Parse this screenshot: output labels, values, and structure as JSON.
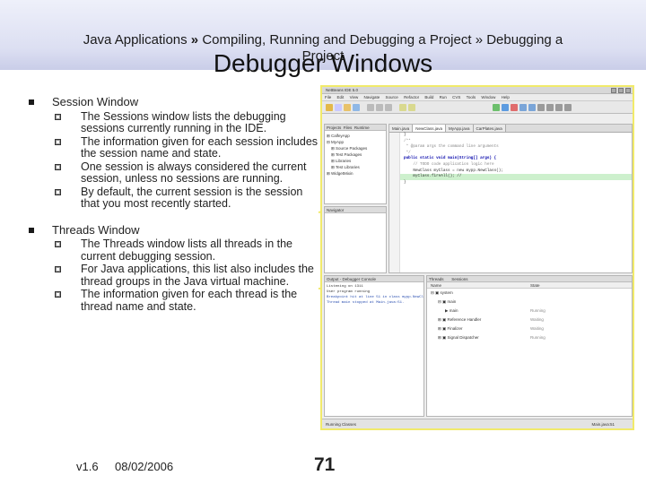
{
  "header": {
    "breadcrumb_part1": "Java Applications",
    "breadcrumb_sep1": "»",
    "breadcrumb_part2": "Compiling, Running and Debugging a Project",
    "breadcrumb_sep2": "»",
    "breadcrumb_part3": "Debugging a",
    "breadcrumb_line2": "Project",
    "title": "Debugger Windows"
  },
  "bullets": [
    {
      "label": "Session Window",
      "items": [
        "The Sessions window lists the debugging sessions currently running in the IDE.",
        "The information given for each session includes the session name and state.",
        "One session is always considered the current session, unless no sessions are running.",
        "By default, the current session is the session that you most recently started."
      ]
    },
    {
      "label": "Threads Window",
      "items": [
        "The Threads window lists all threads in the current debugging session.",
        "For Java applications, this list also includes the thread groups in the Java virtual machine.",
        "The information given for each thread is the thread name and state."
      ]
    }
  ],
  "screenshot": {
    "window_title": "NetBeans IDE 5.0",
    "menu": [
      "File",
      "Edit",
      "View",
      "Navigate",
      "Source",
      "Refactor",
      "Build",
      "Run",
      "CVS",
      "Tools",
      "Window",
      "Help"
    ],
    "projects_tabs": [
      "Projects",
      "Files",
      "Runtime"
    ],
    "project_tree": [
      "CalfeyApp",
      "MyApp",
      "Source Packages",
      "Test Packages",
      "Libraries",
      "Test Libraries",
      "WidgetMixin"
    ],
    "navigator_label": "Navigator",
    "editor_tabs": [
      "Main.java",
      "NewClass.java",
      "MyApp.java",
      "CarPlates.java"
    ],
    "code_lines": [
      "}",
      "",
      "/**",
      " * @param args the command line arguments",
      " */",
      "public static void main(String[] args) {",
      "    // TODO code application logic here",
      "    NewClass myClass = new mypp.NewClass();",
      "    myClass.fireAll(); //",
      "}"
    ],
    "output_tab": "Output - Debugger Console",
    "output_lines": [
      "Listening on 1311",
      "User program running",
      "Breakpoint hit at line 51 in class mypp.NewCl",
      "Thread main stopped at Main.java:51."
    ],
    "threads_tabs": [
      "Threads",
      "Sessions"
    ],
    "threads_columns": [
      "Name",
      "State"
    ],
    "threads_rows": [
      {
        "name": "system",
        "state": ""
      },
      {
        "name": "main",
        "state": ""
      },
      {
        "name": "main",
        "state": "Running"
      },
      {
        "name": "Reference Handler",
        "state": "Waiting"
      },
      {
        "name": "Finalizer",
        "state": "Waiting"
      },
      {
        "name": "Signal Dispatcher",
        "state": "Running"
      }
    ],
    "status_text": "Running   Classes",
    "status_right": "Main.java:51"
  },
  "footer": {
    "version": "v1.6",
    "date": "08/02/2006",
    "page": "71"
  },
  "colors": {
    "header_band": "#dcdff2",
    "callout_line": "#f1ea6a",
    "highlight_line": "#cdf0cd"
  }
}
